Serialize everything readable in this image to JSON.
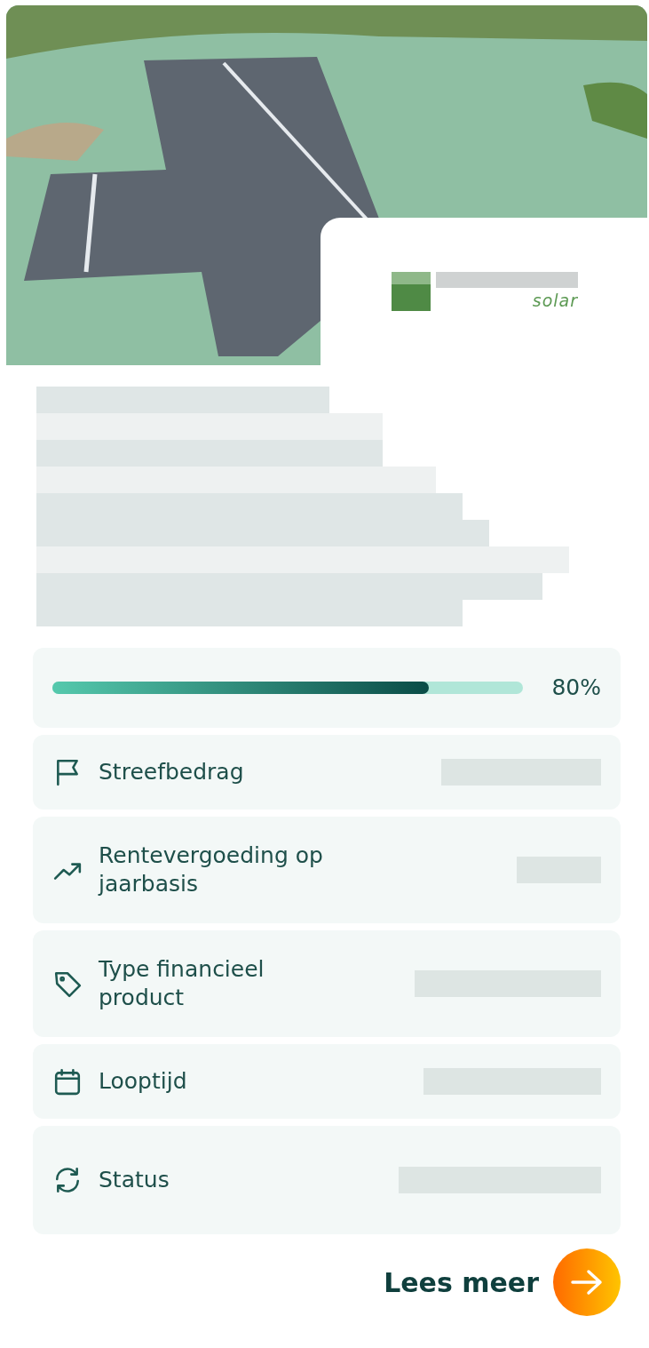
{
  "logo": {
    "tagline": "solar"
  },
  "progress": {
    "level": 0.8,
    "reading": "80%"
  },
  "details": [
    {
      "kind": "flag",
      "label": "Streefbedrag"
    },
    {
      "kind": "trend",
      "label": "Rentevergoeding op jaarbasis"
    },
    {
      "kind": "tag",
      "label": "Type financieel product"
    },
    {
      "kind": "calendar",
      "label": "Looptijd"
    },
    {
      "kind": "refresh",
      "label": "Status"
    }
  ],
  "read_more": {
    "label": "Lees meer"
  }
}
